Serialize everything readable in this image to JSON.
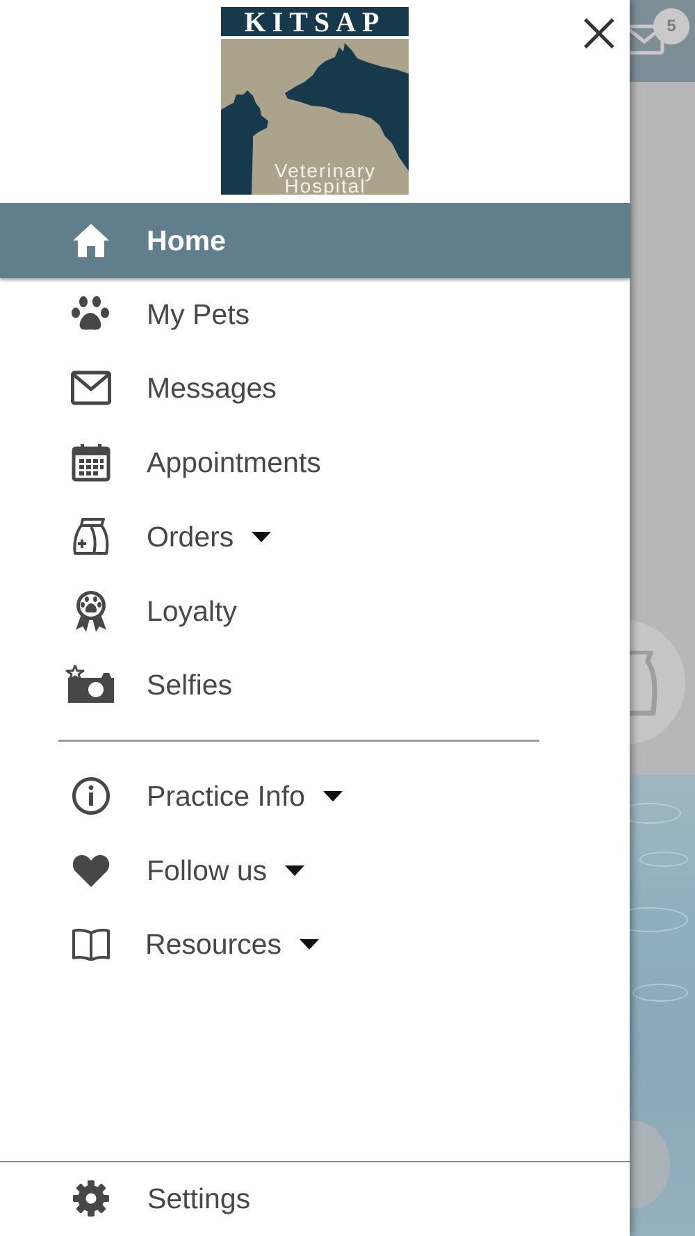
{
  "background": {
    "message_badge_count": "5"
  },
  "drawer": {
    "logo": {
      "word": "KITSAP",
      "subtitle_line1": "Veterinary",
      "subtitle_line2": "Hospital"
    },
    "menu": [
      {
        "label": "Home",
        "icon": "home-icon",
        "active": true
      },
      {
        "label": "My Pets",
        "icon": "paw-icon"
      },
      {
        "label": "Messages",
        "icon": "envelope-icon"
      },
      {
        "label": "Appointments",
        "icon": "calendar-icon"
      },
      {
        "label": "Orders",
        "icon": "pet-food-bag-icon",
        "expandable": true
      },
      {
        "label": "Loyalty",
        "icon": "paw-ribbon-award-icon"
      },
      {
        "label": "Selfies",
        "icon": "camera-sparkle-icon"
      }
    ],
    "secondary_menu": [
      {
        "label": "Practice Info",
        "icon": "info-icon",
        "expandable": true
      },
      {
        "label": "Follow us",
        "icon": "heart-icon",
        "expandable": true
      },
      {
        "label": "Resources",
        "icon": "book-icon",
        "expandable": true
      }
    ],
    "footer": {
      "label": "Settings",
      "icon": "gear-icon"
    }
  },
  "colors": {
    "active_background": "#617e8c",
    "logo_dark": "#163a4c",
    "logo_tan": "#aca38c",
    "text": "#474747",
    "icon": "#474747"
  }
}
